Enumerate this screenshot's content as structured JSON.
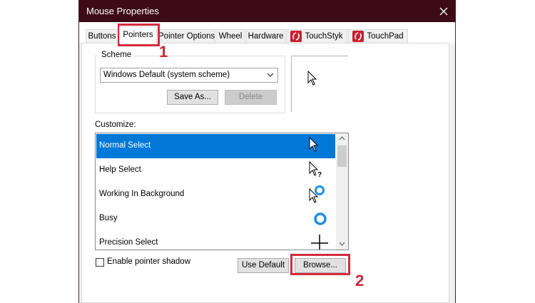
{
  "window": {
    "title": "Mouse Properties"
  },
  "tabs": [
    {
      "label": "Buttons"
    },
    {
      "label": "Pointers"
    },
    {
      "label": "Pointer Options"
    },
    {
      "label": "Wheel"
    },
    {
      "label": "Hardware"
    },
    {
      "label": "TouchStyk"
    },
    {
      "label": "TouchPad"
    }
  ],
  "scheme": {
    "group_label": "Scheme",
    "selected": "Windows Default (system scheme)",
    "save_as_label": "Save As...",
    "delete_label": "Delete"
  },
  "customize": {
    "label": "Customize:",
    "items": [
      {
        "label": "Normal Select",
        "icon": "arrow-pointer-icon"
      },
      {
        "label": "Help Select",
        "icon": "help-pointer-icon"
      },
      {
        "label": "Working In Background",
        "icon": "working-pointer-icon"
      },
      {
        "label": "Busy",
        "icon": "busy-ring-icon"
      },
      {
        "label": "Precision Select",
        "icon": "crosshair-icon"
      }
    ],
    "selected_index": 0
  },
  "options": {
    "shadow_label": "Enable pointer shadow",
    "use_default_label": "Use Default",
    "browse_label": "Browse..."
  },
  "annotations": {
    "step1": "1",
    "step2": "2"
  },
  "colors": {
    "titlebar": "#3d0b16",
    "selection": "#0078d7",
    "annotation": "#d22c3c",
    "busy": "#1e8fe1"
  }
}
